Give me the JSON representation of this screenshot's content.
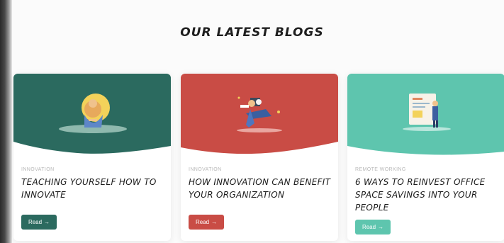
{
  "section": {
    "title": "OUR LATEST BLOGS"
  },
  "posts": [
    {
      "category": "INNOVATION",
      "title": "TEACHING YOURSELF HOW TO INNOVATE",
      "button_label": "Read",
      "button_icon": "arrow-right-icon",
      "accent": "#2b6a5f",
      "illustration": "person-with-bulb-illustration"
    },
    {
      "category": "INNOVATION",
      "title": "HOW INNOVATION CAN BENEFIT YOUR ORGANIZATION",
      "button_label": "Read",
      "button_icon": "arrow-right-icon",
      "accent": "#c94c45",
      "illustration": "person-at-desk-illustration"
    },
    {
      "category": "REMOTE WORKING",
      "title": "6 WAYS TO REINVEST OFFICE SPACE SAVINGS INTO YOUR PEOPLE",
      "button_label": "Read",
      "button_icon": "arrow-right-icon",
      "accent": "#5ec5ae",
      "illustration": "person-with-board-illustration"
    }
  ]
}
